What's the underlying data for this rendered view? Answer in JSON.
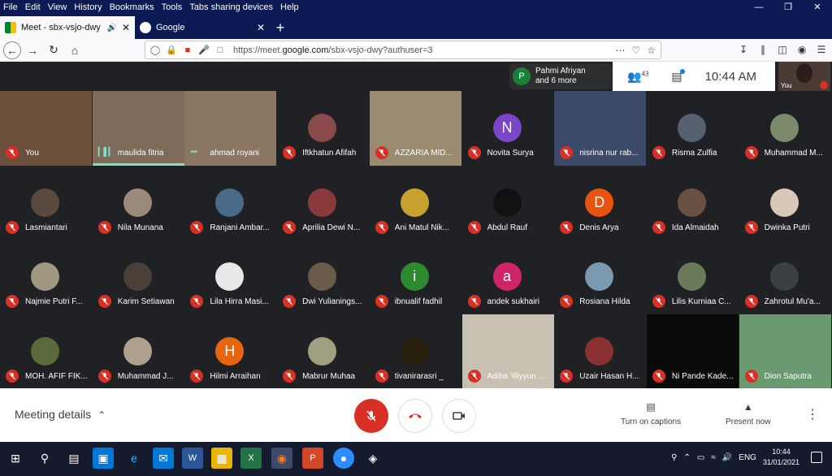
{
  "menubar": {
    "items": [
      "File",
      "Edit",
      "View",
      "History",
      "Bookmarks",
      "Tools",
      "Tabs sharing devices",
      "Help"
    ]
  },
  "tabs": [
    {
      "label": "Meet - sbx-vsjo-dwy",
      "active": true
    },
    {
      "label": "Google",
      "active": false
    }
  ],
  "address": {
    "url_prefix": "https://meet.",
    "url_domain": "google.com",
    "url_suffix": "/sbx-vsjo-dwy?authuser=3"
  },
  "topbar": {
    "presenter_initial": "P",
    "presenter_name": "Pahmi Afriyan",
    "presenter_more": "and 6 more",
    "people_count": "43",
    "time": "10:44 AM",
    "self_label": "You"
  },
  "participants": [
    {
      "name": "You",
      "type": "video",
      "color": "#6b4f3a",
      "muted": true
    },
    {
      "name": "maulida fitria",
      "type": "video",
      "color": "#7d6a58",
      "muted": false,
      "speaking": true
    },
    {
      "name": "ahmad royani",
      "type": "video",
      "color": "#8a7560",
      "muted": false,
      "speaking": false
    },
    {
      "name": "Iftkhatun Afifah",
      "type": "photo",
      "color": "#8a4a4a",
      "muted": true
    },
    {
      "name": "AZZARIA MID...",
      "type": "video",
      "color": "#9a8a70",
      "muted": true
    },
    {
      "name": "Novita Surya",
      "type": "letter",
      "letter": "N",
      "color": "#7b45c8",
      "muted": true
    },
    {
      "name": "nisrina nur rab...",
      "type": "video",
      "color": "#3a4a68",
      "muted": true
    },
    {
      "name": "Risma Zulfia",
      "type": "photo",
      "color": "#556070",
      "muted": true
    },
    {
      "name": "Muhammad M...",
      "type": "photo",
      "color": "#7a8a6a",
      "muted": true
    },
    {
      "name": "Lasmiantari",
      "type": "photo",
      "color": "#5a4a40",
      "muted": true
    },
    {
      "name": "Nila Munana",
      "type": "photo",
      "color": "#9a8a7a",
      "muted": true
    },
    {
      "name": "Ranjani Ambar...",
      "type": "photo",
      "color": "#4a6a8a",
      "muted": true
    },
    {
      "name": "Aprilia Dewi N...",
      "type": "photo",
      "color": "#8a3a3a",
      "muted": true
    },
    {
      "name": "Ani Matul Nik...",
      "type": "photo",
      "color": "#c8a030",
      "muted": true
    },
    {
      "name": "Abdul Rauf",
      "type": "photo",
      "color": "#111111",
      "muted": true
    },
    {
      "name": "Denis Arya",
      "type": "letter",
      "letter": "D",
      "color": "#e8540f",
      "muted": true
    },
    {
      "name": "Ida Almaidah",
      "type": "photo",
      "color": "#6a5040",
      "muted": true
    },
    {
      "name": "Dwinka Putri",
      "type": "photo",
      "color": "#d8c8b8",
      "muted": true
    },
    {
      "name": "Najmie Putri F...",
      "type": "photo",
      "color": "#a09880",
      "muted": true
    },
    {
      "name": "Karim Setiawan",
      "type": "photo",
      "color": "#4a4038",
      "muted": true
    },
    {
      "name": "Lila Hirra Masi...",
      "type": "photo",
      "color": "#e8e8e8",
      "muted": true
    },
    {
      "name": "Dwi Yulianings...",
      "type": "photo",
      "color": "#6a5a4a",
      "muted": true
    },
    {
      "name": "ibnualif fadhil",
      "type": "letter",
      "letter": "i",
      "color": "#2e8a2e",
      "muted": true
    },
    {
      "name": "andek sukhairi",
      "type": "letter",
      "letter": "a",
      "color": "#d0246a",
      "muted": true
    },
    {
      "name": "Rosiana Hilda",
      "type": "photo",
      "color": "#7a9ab0",
      "muted": true
    },
    {
      "name": "Lilis Kurniaa C...",
      "type": "photo",
      "color": "#6a7a5a",
      "muted": true
    },
    {
      "name": "Zahrotul Mu'a...",
      "type": "photo",
      "color": "#3c4043",
      "muted": true
    },
    {
      "name": "MOH. AFIF FIK...",
      "type": "photo",
      "color": "#5a6a3a",
      "muted": true
    },
    {
      "name": "Muhammad J...",
      "type": "photo",
      "color": "#b0a090",
      "muted": true
    },
    {
      "name": "Hilmi Arraihan",
      "type": "letter",
      "letter": "H",
      "color": "#e8650f",
      "muted": true
    },
    {
      "name": "Mabrur Muhaa",
      "type": "photo",
      "color": "#a0a080",
      "muted": true
    },
    {
      "name": "tivanirarasri _",
      "type": "photo",
      "color": "#2a2010",
      "muted": true
    },
    {
      "name": "Adiba 'illiyyun ...",
      "type": "video",
      "color": "#c8c0b0",
      "muted": true
    },
    {
      "name": "Uzair Hasan H...",
      "type": "photo",
      "color": "#8a3030",
      "muted": true
    },
    {
      "name": "Ni Pande Kade...",
      "type": "video",
      "color": "#0a0a0a",
      "muted": true
    },
    {
      "name": "Dion Saputra",
      "type": "video",
      "color": "#6a9a70",
      "muted": true
    }
  ],
  "bottom": {
    "meeting_details": "Meeting details",
    "captions": "Turn on captions",
    "present": "Present now"
  },
  "taskbar": {
    "lang": "ENG",
    "time": "10:44",
    "date": "31/01/2021"
  }
}
